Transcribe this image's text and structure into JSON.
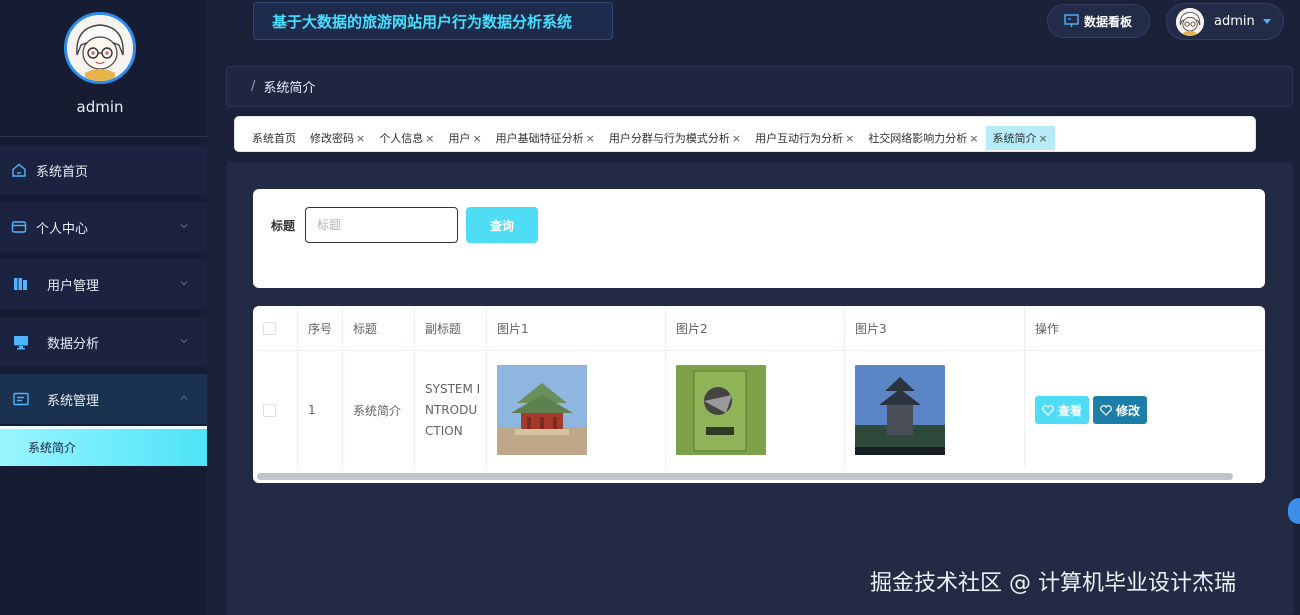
{
  "header": {
    "app_title": "基于大数据的旅游网站用户行为数据分析系统",
    "dashboard_label": "数据看板",
    "username": "admin"
  },
  "sidebar": {
    "username": "admin",
    "items": [
      {
        "label": "系统首页"
      },
      {
        "label": "个人中心"
      },
      {
        "label": "用户管理"
      },
      {
        "label": "数据分析"
      },
      {
        "label": "系统管理"
      }
    ],
    "sub_item": "系统简介"
  },
  "breadcrumb": {
    "separator": "/",
    "current": "系统简介"
  },
  "tags": [
    {
      "label": "系统首页",
      "closable": false
    },
    {
      "label": "修改密码",
      "closable": true
    },
    {
      "label": "个人信息",
      "closable": true
    },
    {
      "label": "用户",
      "closable": true
    },
    {
      "label": "用户基础特征分析",
      "closable": true
    },
    {
      "label": "用户分群与行为模式分析",
      "closable": true
    },
    {
      "label": "用户互动行为分析",
      "closable": true
    },
    {
      "label": "社交网络影响力分析",
      "closable": true
    },
    {
      "label": "系统简介",
      "closable": true
    }
  ],
  "tag_close": "×",
  "search": {
    "label": "标题",
    "placeholder": "标题",
    "button": "查询"
  },
  "table": {
    "headers": [
      "序号",
      "标题",
      "副标题",
      "图片1",
      "图片2",
      "图片3",
      "操作"
    ],
    "rows": [
      {
        "index": "1",
        "title": "系统简介",
        "subtitle": "SYSTEM INTRODUCTION"
      }
    ],
    "view_label": "查看",
    "edit_label": "修改"
  },
  "watermark": "掘金技术社区 @ 计算机毕业设计杰瑞",
  "colors": {
    "accent": "#4fdcf5",
    "edit_button": "#1d7fa8",
    "title_text": "#45e0ff",
    "background": "#1a2138"
  }
}
